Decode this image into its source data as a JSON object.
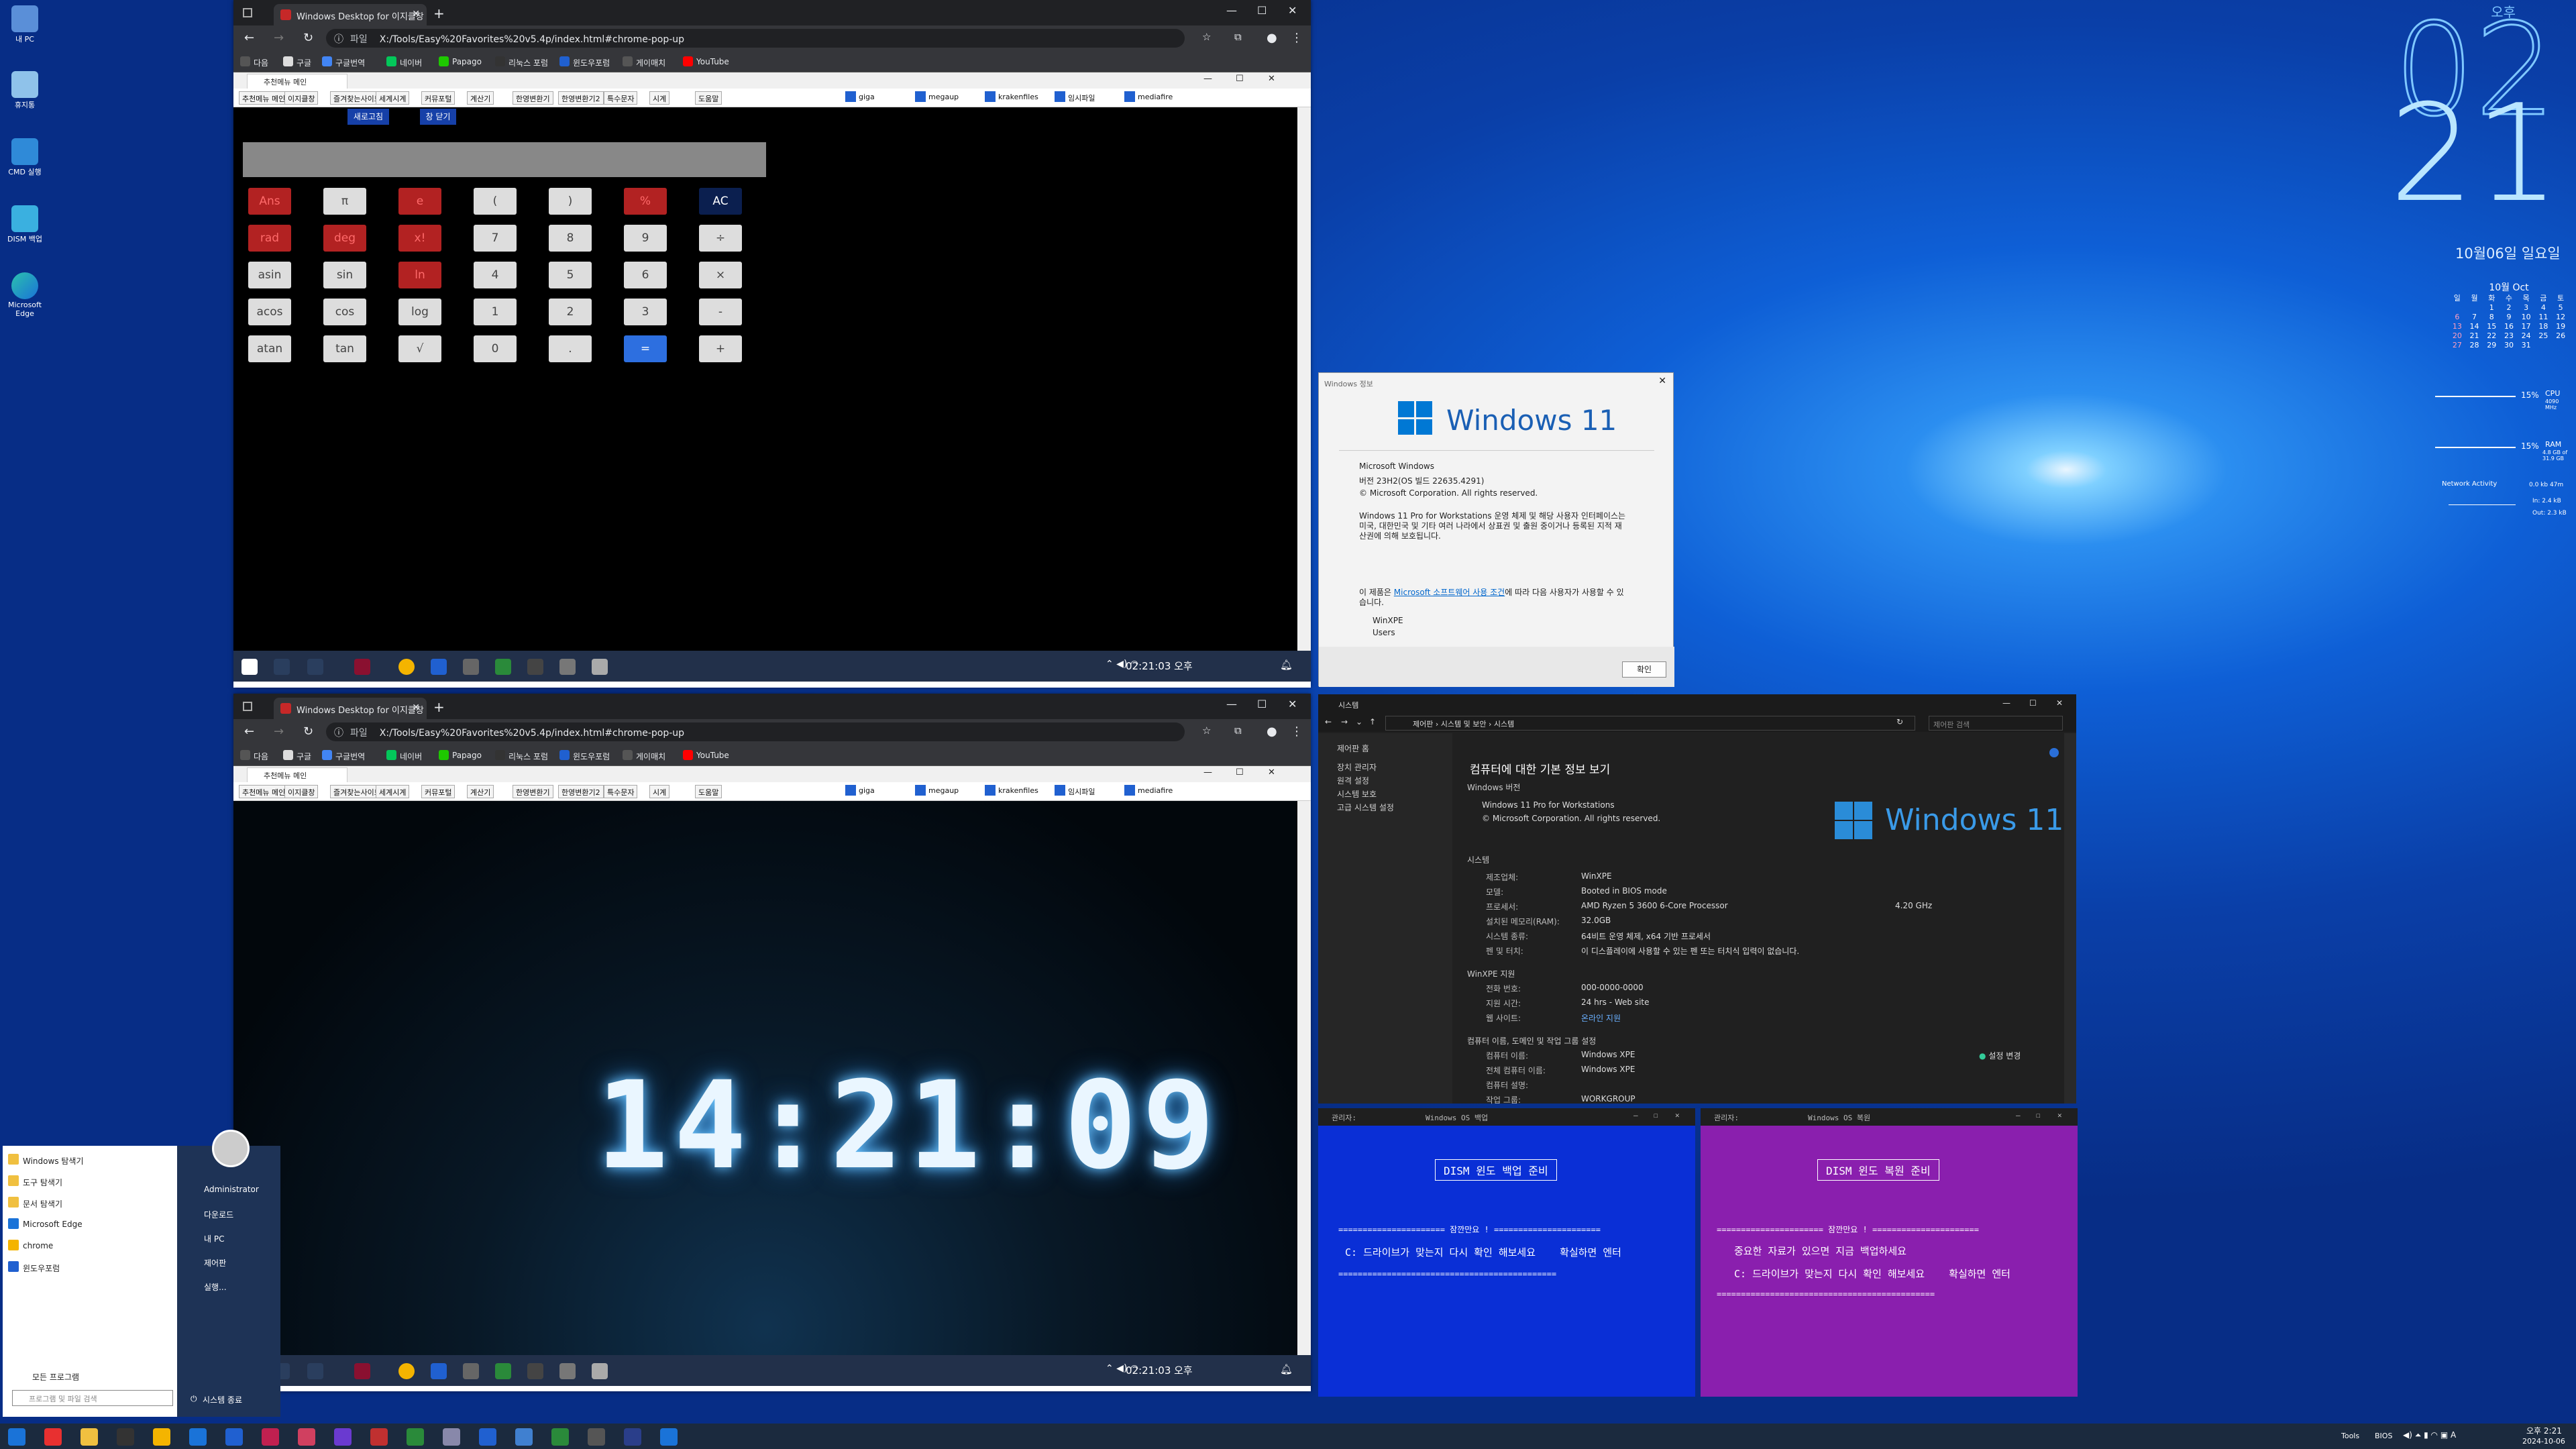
{
  "desktop": {
    "icons": [
      "내 PC",
      "휴지통",
      "CMD 실행",
      "DISM 백업",
      "Microsoft Edge"
    ]
  },
  "clock_widget": {
    "ampm": "오후",
    "hour": "02",
    "minute": "21",
    "date": "10월06일 일요일"
  },
  "calendar": {
    "title": "10월 Oct",
    "weekdays": [
      "일",
      "월",
      "화",
      "수",
      "목",
      "금",
      "토"
    ],
    "rows": [
      [
        "",
        "",
        "1",
        "2",
        "3",
        "4",
        "5"
      ],
      [
        "6",
        "7",
        "8",
        "9",
        "10",
        "11",
        "12"
      ],
      [
        "13",
        "14",
        "15",
        "16",
        "17",
        "18",
        "19"
      ],
      [
        "20",
        "21",
        "22",
        "23",
        "24",
        "25",
        "26"
      ],
      [
        "27",
        "28",
        "29",
        "30",
        "31",
        "",
        ""
      ]
    ]
  },
  "sysmon": {
    "cpu_label": "CPU",
    "cpu_pct": "15%",
    "cpu_sub": "4090 MHz",
    "ram_label": "RAM",
    "ram_pct": "15%",
    "ram_sub": "4.8 GB of 31.9 GB",
    "net_label": "Network Activity",
    "net_val": "0.0 kb 47m",
    "in": "In: 2.4 kB",
    "out": "Out: 2.3 kB"
  },
  "browser": {
    "tab_title": "Windows Desktop for 이지클창",
    "site_label": "파일",
    "url": "X:/Tools/Easy%20Favorites%20v5.4p/index.html#chrome-pop-up",
    "bookmarks": [
      "다음",
      "구글",
      "구글번역",
      "네이버",
      "Papago",
      "리눅스 포럼",
      "윈도우포럼",
      "게이매치",
      "YouTube"
    ],
    "inner_tab": "추천메뉴 메인",
    "menu": [
      "추천메뉴 메인",
      "이지클창",
      "즐겨찾는사이트",
      "세계시계",
      "커뮤포털",
      "계산기",
      "한영변환기",
      "한영변환기2",
      "특수문자",
      "시계",
      "도움말"
    ],
    "menu_links": [
      "giga",
      "megaup",
      "krakenfiles",
      "임시파일",
      "mediafire"
    ],
    "time": "02:21:03 오후"
  },
  "calculator": {
    "top_buttons": [
      "새로고침",
      "창 닫기"
    ],
    "buttons": [
      [
        "Ans",
        "π",
        "e",
        "(",
        ")",
        "%",
        "AC"
      ],
      [
        "rad",
        "deg",
        "x!",
        "7",
        "8",
        "9",
        "÷"
      ],
      [
        "asin",
        "sin",
        "ln",
        "4",
        "5",
        "6",
        "×"
      ],
      [
        "acos",
        "cos",
        "log",
        "1",
        "2",
        "3",
        "-"
      ],
      [
        "atan",
        "tan",
        "√",
        "0",
        ".",
        "=",
        "+"
      ]
    ]
  },
  "led_clock": {
    "time": "14:21:09"
  },
  "about": {
    "title": "Windows 정보",
    "logo": "Windows 11",
    "product": "Microsoft Windows",
    "version": "버전 23H2(OS 빌드 22635.4291)",
    "copyright": "© Microsoft Corporation. All rights reserved.",
    "desc": "Windows 11 Pro for Workstations 운영 체제 및 해당 사용자 인터페이스는 미국, 대한민국 및 기타 여러 나라에서 상표권 및 출원 중이거나 등록된 지적 재산권에 의해 보호됩니다.",
    "license_pre": "이 제품은 ",
    "license_link": "Microsoft 소프트웨어 사용 조건",
    "license_post": "에 따라 다음 사용자가 사용할 수 있습니다.",
    "user1": "WinXPE",
    "user2": "Users",
    "ok": "확인"
  },
  "system": {
    "title": "시스템",
    "path": [
      "제어판",
      "시스템 및 보안",
      "시스템"
    ],
    "search": "제어판 검색",
    "side_home": "제어판 홈",
    "side": [
      "장치 관리자",
      "원격 설정",
      "시스템 보호",
      "고급 시스템 설정"
    ],
    "heading": "컴퓨터에 대한 기본 정보 보기",
    "edition_h": "Windows 버전",
    "edition": "Windows 11 Pro for Workstations",
    "edition_c": "© Microsoft Corporation. All rights reserved.",
    "logo": "Windows 11",
    "sys_h": "시스템",
    "rows": [
      [
        "제조업체:",
        "WinXPE"
      ],
      [
        "모델:",
        "Booted in BIOS mode"
      ],
      [
        "프로세서:",
        "AMD Ryzen 5 3600 6-Core Processor"
      ],
      [
        "설치된 메모리(RAM):",
        "32.0GB"
      ],
      [
        "시스템 종류:",
        "64비트 운영 체제, x64 기반 프로세서"
      ],
      [
        "펜 및 터치:",
        "이 디스플레이에 사용할 수 있는 펜 또는 터치식 입력이 없습니다."
      ]
    ],
    "ghz": "4.20 GHz",
    "support_h": "WinXPE 지원",
    "support": [
      [
        "전화 번호:",
        "000-0000-0000"
      ],
      [
        "지원 시간:",
        "24 hrs - Web site"
      ],
      [
        "웹 사이트:",
        "온라인 지원"
      ]
    ],
    "comp_h": "컴퓨터 이름, 도메인 및 작업 그룹 설정",
    "comp": [
      [
        "컴퓨터 이름:",
        "Windows XPE"
      ],
      [
        "전체 컴퓨터 이름:",
        "Windows XPE"
      ],
      [
        "컴퓨터 설명:",
        ""
      ],
      [
        "작업 그룹:",
        "WORKGROUP"
      ]
    ],
    "change": "설정 변경"
  },
  "dism_backup": {
    "title_l": "관리자:",
    "title": "Windows OS 백업",
    "header": "DISM 윈도 백업 준비",
    "banner": "====================== 잠깐만요 ! ======================",
    "line1": "C: 드라이브가 맞는지 다시 확인 해보세요    확실하면 엔터",
    "sep": "=============================================",
    "bg": "#0a2fd6"
  },
  "dism_restore": {
    "title_l": "관리자:",
    "title": "Windows OS 복원",
    "header": "DISM 윈도 복원 준비",
    "banner": "====================== 잠깐만요 ! ======================",
    "line1": "중요한 자료가 있으면 지금 백업하세요",
    "line2": "C: 드라이브가 맞는지 다시 확인 해보세요    확실하면 엔터",
    "sep": "=============================================",
    "bg": "#8a1fae"
  },
  "start_menu": {
    "left": [
      "Windows 탐색기",
      "도구 탐색기",
      "문서 탐색기",
      "Microsoft Edge",
      "chrome",
      "윈도우포럼"
    ],
    "right": [
      "Administrator",
      "다운로드",
      "내 PC",
      "제어판",
      "실행..."
    ],
    "all": "모든 프로그램",
    "search": "프로그램 및 파일 검색",
    "shutdown": "시스템 종료"
  },
  "taskbar": {
    "tools": "Tools",
    "bios": "BIOS",
    "time": "오후 2:21",
    "date": "2024-10-06"
  }
}
